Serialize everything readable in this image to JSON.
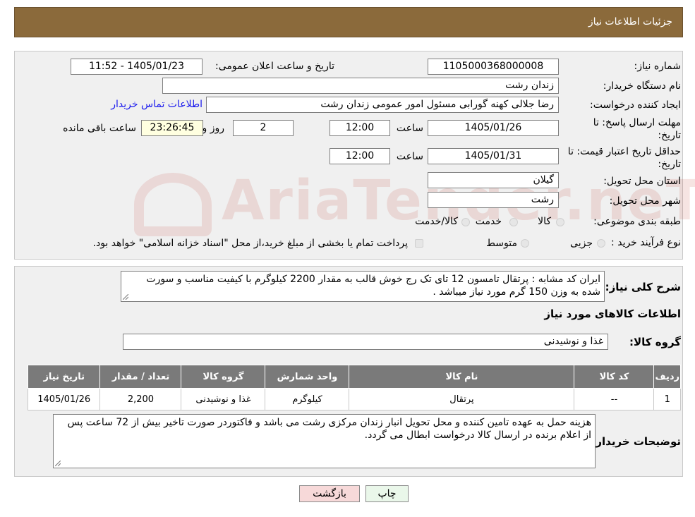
{
  "header": {
    "title": "جزئیات اطلاعات نیاز"
  },
  "form": {
    "need_number_label": "شماره نیاز:",
    "need_number": "1105000368000008",
    "announce_label": "تاریخ و ساعت اعلان عمومی:",
    "announce_value": "1405/01/23 - 11:52",
    "buyer_org_label": "نام دستگاه خریدار:",
    "buyer_org": "زندان رشت",
    "requester_label": "ایجاد کننده درخواست:",
    "requester": "رضا جلالی کهنه گورابی مسئول امور عمومی زندان رشت",
    "contact_link": "اطلاعات تماس خریدار",
    "deadline_label_1": "مهلت ارسال پاسخ: تا",
    "deadline_label_2": "تاریخ:",
    "deadline_date": "1405/01/26",
    "time_label": "ساعت",
    "deadline_time": "12:00",
    "days_value": "2",
    "days_label": "روز و",
    "remaining_time": "23:26:45",
    "remaining_label": "ساعت باقی مانده",
    "validity_label_1": "حداقل تاریخ اعتبار قیمت: تا",
    "validity_label_2": "تاریخ:",
    "validity_date": "1405/01/31",
    "validity_time": "12:00",
    "province_label": "استان محل تحویل:",
    "province": "گیلان",
    "city_label": "شهر محل تحویل:",
    "city": "رشت",
    "category_label": "طبقه بندی موضوعی:",
    "category_options": [
      "کالا",
      "خدمت",
      "کالا/خدمت"
    ],
    "process_label": "نوع فرآیند خرید :",
    "process_options": [
      "جزیی",
      "متوسط"
    ],
    "process_note": "پرداخت تمام یا بخشی از مبلغ خرید،از محل \"اسناد خزانه اسلامی\" خواهد بود."
  },
  "description": {
    "label": "شرح کلی نیاز:",
    "text": "ایران کد مشابه : پرتقال تامسون 12 تای تک رج خوش قالب به مقدار 2200 کیلوگرم با کیفیت مناسب و سورت شده به وزن 150 گرم مورد نیاز میباشد ."
  },
  "goods": {
    "section_title": "اطلاعات کالاهای مورد نیاز",
    "group_label": "گروه کالا:",
    "group_value": "غذا و نوشیدنی",
    "columns": [
      "ردیف",
      "کد کالا",
      "نام کالا",
      "واحد شمارش",
      "گروه کالا",
      "تعداد / مقدار",
      "تاریخ نیاز"
    ],
    "rows": [
      [
        "1",
        "--",
        "پرتقال",
        "کیلوگرم",
        "غذا و نوشیدنی",
        "2,200",
        "1405/01/26"
      ]
    ]
  },
  "buyer_notes": {
    "label": "توضیحات خریدار:",
    "text": "هزینه حمل به عهده تامین کننده و محل تحویل انبار زندان مرکزی رشت می باشد و فاکتوردر صورت تاخیر بیش از 72 ساعت پس از اعلام برنده در ارسال کالا درخواست ابطال می گردد."
  },
  "buttons": {
    "print": "چاپ",
    "back": "بازگشت"
  },
  "watermark": {
    "text": "AriaTender.neT"
  },
  "colors": {
    "header_bg": "#8b6a3b",
    "panel_bg": "#f0f0f0",
    "table_header_bg": "#7a7a7a",
    "link": "#1a1aee",
    "back_button_bg": "#f7d9d9",
    "print_button_bg": "#eaf7ea"
  }
}
